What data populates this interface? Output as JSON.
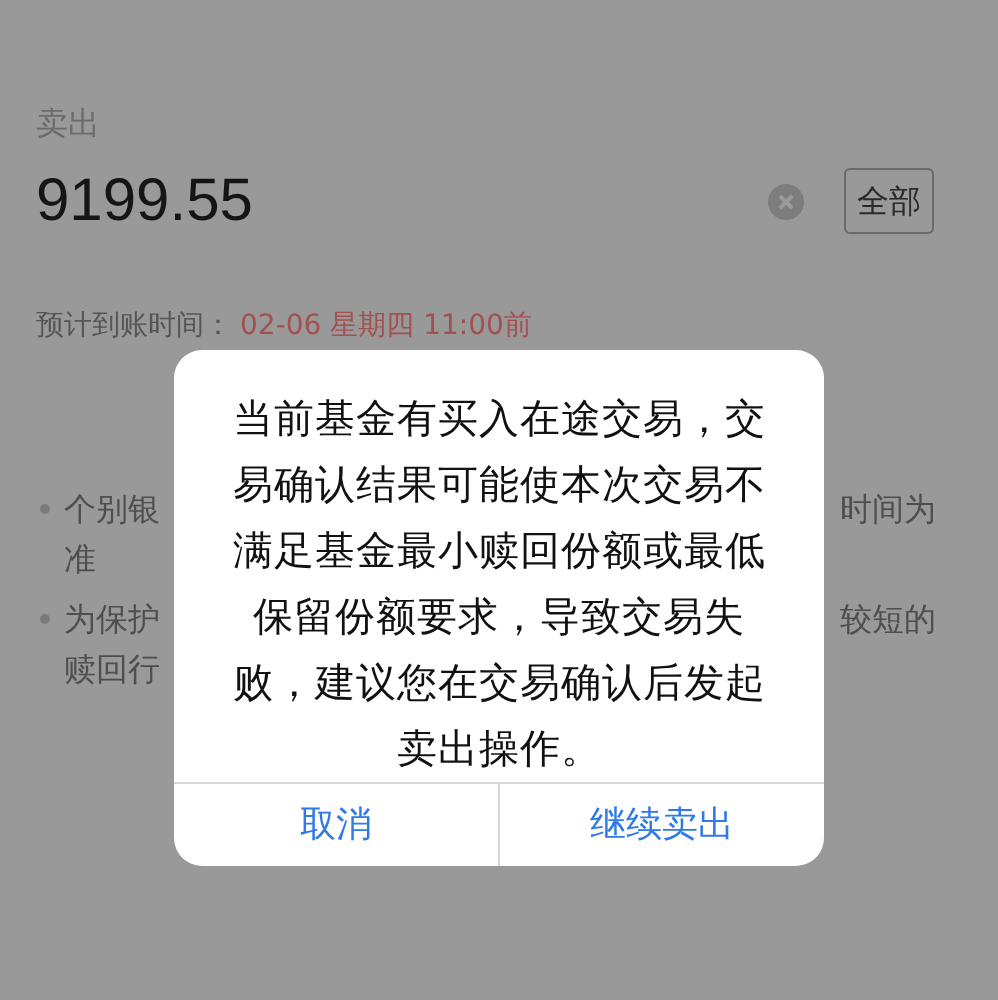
{
  "form": {
    "label": "卖出",
    "amount": "9199.55",
    "all_button": "全部",
    "arrival_label": "预计到账时间：",
    "arrival_time": "02-06 星期四 11:00前"
  },
  "notes": [
    {
      "visible_start": "个别银",
      "visible_end": "时间为",
      "continuation": "准"
    },
    {
      "visible_start": "为保护",
      "visible_end": "较短的",
      "continuation": "赎回行"
    }
  ],
  "dialog": {
    "message": "当前基金有买入在途交易，交易确认结果可能使本次交易不满足基金最小赎回份额或最低保留份额要求，导致交易失败，建议您在交易确认后发起卖出操作。",
    "buttons": [
      {
        "label": "取消"
      },
      {
        "label": "继续卖出"
      }
    ]
  }
}
